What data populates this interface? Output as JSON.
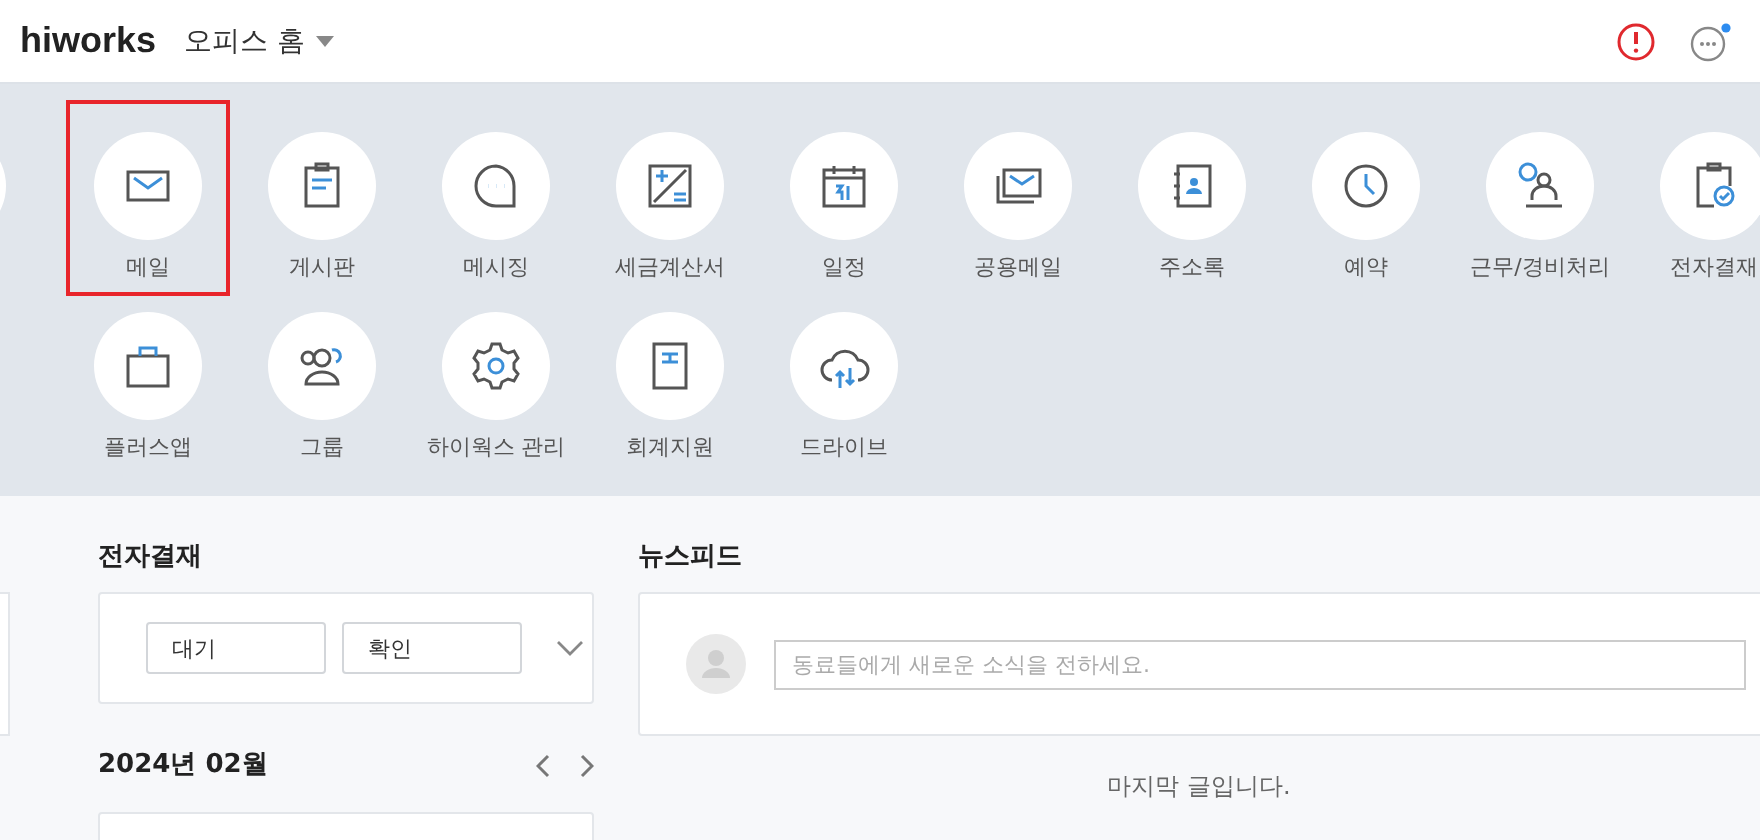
{
  "header": {
    "logo": "hiworks",
    "menu": "오피스 홈",
    "has_notification": true
  },
  "apps": [
    {
      "label": "메일",
      "kind": "mail",
      "selected": true
    },
    {
      "label": "게시판",
      "kind": "board",
      "selected": false
    },
    {
      "label": "메시징",
      "kind": "chat",
      "selected": false
    },
    {
      "label": "세금계산서",
      "kind": "tax",
      "selected": false
    },
    {
      "label": "일정",
      "kind": "calendar",
      "selected": false
    },
    {
      "label": "공용메일",
      "kind": "sharedmail",
      "selected": false
    },
    {
      "label": "주소록",
      "kind": "contacts",
      "selected": false
    },
    {
      "label": "예약",
      "kind": "clock",
      "selected": false
    },
    {
      "label": "근무/경비처리",
      "kind": "work",
      "selected": false
    },
    {
      "label": "전자결재",
      "kind": "approval",
      "selected": false
    },
    {
      "label": "플러스앱",
      "kind": "bag",
      "selected": false
    },
    {
      "label": "그룹",
      "kind": "group",
      "selected": false
    },
    {
      "label": "하이웍스 관리",
      "kind": "gear",
      "selected": false
    },
    {
      "label": "회계지원",
      "kind": "ledger",
      "selected": false
    },
    {
      "label": "드라이브",
      "kind": "cloud",
      "selected": false
    }
  ],
  "approval": {
    "title": "전자결재",
    "buttons": [
      "대기",
      "확인"
    ]
  },
  "calendar": {
    "title": "2024년 02월"
  },
  "newsfeed": {
    "title": "뉴스피드",
    "placeholder": "동료들에게 새로운 소식을 전하세요.",
    "footer": "마지막 글입니다."
  }
}
